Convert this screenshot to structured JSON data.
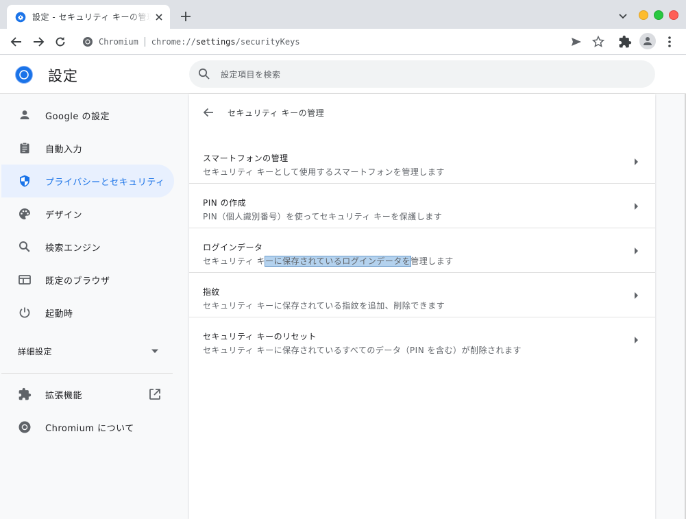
{
  "browser": {
    "tab_title": "設定 - セキュリティ キーの管理",
    "omnibox": {
      "site_name": "Chromium",
      "url_prefix": "chrome://",
      "url_host": "settings",
      "url_path": "/securityKeys"
    }
  },
  "header": {
    "title": "設定",
    "search_placeholder": "設定項目を検索"
  },
  "sidebar": {
    "items": [
      {
        "label": "Google の設定",
        "icon": "person-icon"
      },
      {
        "label": "自動入力",
        "icon": "clipboard-icon"
      },
      {
        "label": "プライバシーとセキュリティ",
        "icon": "shield-icon",
        "active": true
      },
      {
        "label": "デザイン",
        "icon": "palette-icon"
      },
      {
        "label": "検索エンジン",
        "icon": "search-icon"
      },
      {
        "label": "既定のブラウザ",
        "icon": "browser-window-icon"
      },
      {
        "label": "起動時",
        "icon": "power-icon"
      }
    ],
    "advanced_label": "詳細設定",
    "extensions_label": "拡張機能",
    "about_label": "Chromium について"
  },
  "main": {
    "title": "セキュリティ キーの管理",
    "rows": [
      {
        "title": "スマートフォンの管理",
        "description": "セキュリティ キーとして使用するスマートフォンを管理します"
      },
      {
        "title": "PIN の作成",
        "description": "PIN（個人識別番号）を使ってセキュリティ キーを保護します"
      },
      {
        "title": "ログインデータ",
        "description_pre": "セキュリティ キ",
        "description_sel": "ーに保存されているログインデータを",
        "description_post": "管理します"
      },
      {
        "title": "指紋",
        "description": "セキュリティ キーに保存されている指紋を追加、削除できます"
      },
      {
        "title": "セキュリティ キーのリセット",
        "description": "セキュリティ キーに保存されているすべてのデータ（PIN を含む）が削除されます"
      }
    ]
  },
  "colors": {
    "accent": "#1a73e8",
    "active_nav_bg": "#e8f0fe",
    "selection": "#b4d2ee"
  }
}
